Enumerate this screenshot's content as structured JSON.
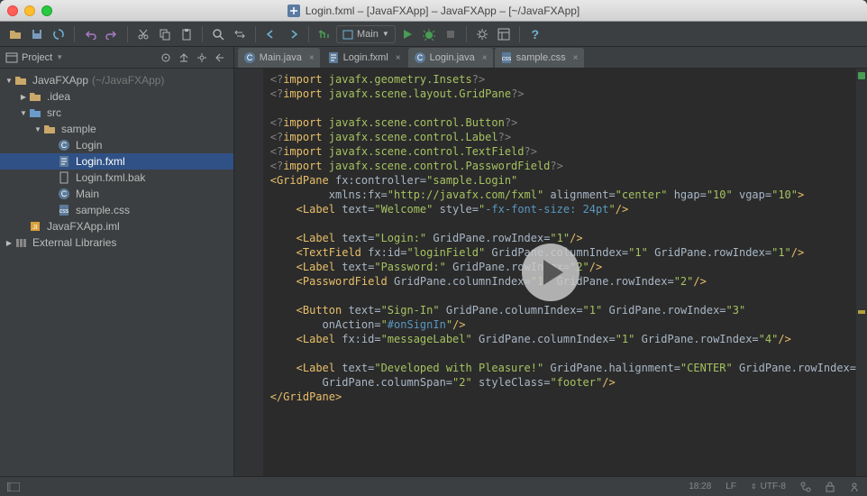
{
  "window_title": "Login.fxml – [JavaFXApp] – JavaFXApp – [~/JavaFXApp]",
  "run_config": "Main",
  "sidebar": {
    "title": "Project",
    "nodes": [
      {
        "indent": 0,
        "arrow": "▼",
        "icon": "folder",
        "label": "JavaFXApp",
        "hint": "(~/JavaFXApp)"
      },
      {
        "indent": 1,
        "arrow": "▶",
        "icon": "folder",
        "label": ".idea",
        "hint": ""
      },
      {
        "indent": 1,
        "arrow": "▼",
        "icon": "src",
        "label": "src",
        "hint": ""
      },
      {
        "indent": 2,
        "arrow": "▼",
        "icon": "pkg",
        "label": "sample",
        "hint": ""
      },
      {
        "indent": 3,
        "arrow": "",
        "icon": "java",
        "label": "Login",
        "hint": ""
      },
      {
        "indent": 3,
        "arrow": "",
        "icon": "fxml",
        "label": "Login.fxml",
        "hint": "",
        "selected": true
      },
      {
        "indent": 3,
        "arrow": "",
        "icon": "file",
        "label": "Login.fxml.bak",
        "hint": ""
      },
      {
        "indent": 3,
        "arrow": "",
        "icon": "java",
        "label": "Main",
        "hint": ""
      },
      {
        "indent": 3,
        "arrow": "",
        "icon": "css",
        "label": "sample.css",
        "hint": ""
      },
      {
        "indent": 1,
        "arrow": "",
        "icon": "iml",
        "label": "JavaFXApp.iml",
        "hint": ""
      },
      {
        "indent": 0,
        "arrow": "▶",
        "icon": "lib",
        "label": "External Libraries",
        "hint": ""
      }
    ]
  },
  "tabs": [
    {
      "icon": "java",
      "label": "Main.java",
      "active": false
    },
    {
      "icon": "fxml",
      "label": "Login.fxml",
      "active": true
    },
    {
      "icon": "java",
      "label": "Login.java",
      "active": false
    },
    {
      "icon": "css",
      "label": "sample.css",
      "active": false
    }
  ],
  "code_html": "<span class='dim'>&lt;?</span><span class='tag'>import </span><span class='str'>javafx.geometry.Insets</span><span class='dim'>?&gt;</span>\n<span class='dim'>&lt;?</span><span class='tag'>import </span><span class='str'>javafx.scene.layout.GridPane</span><span class='dim'>?&gt;</span>\n\n<span class='dim'>&lt;?</span><span class='tag'>import </span><span class='str'>javafx.scene.control.Button</span><span class='dim'>?&gt;</span>\n<span class='dim'>&lt;?</span><span class='tag'>import </span><span class='str'>javafx.scene.control.Label</span><span class='dim'>?&gt;</span>\n<span class='dim'>&lt;?</span><span class='tag'>import </span><span class='str'>javafx.scene.control.TextField</span><span class='dim'>?&gt;</span>\n<span class='dim'>&lt;?</span><span class='tag'>import </span><span class='str'>javafx.scene.control.PasswordField</span><span class='dim'>?&gt;</span>\n<span class='tag'>&lt;GridPane </span><span class='attr'>fx:controller=</span><span class='str'>\"sample.Login\"</span>\n         <span class='attr'>xmlns:fx=</span><span class='str'>\"http://javafx.com/fxml\"</span> <span class='attr'>alignment=</span><span class='str'>\"center\"</span> <span class='attr'>hgap=</span><span class='str'>\"10\"</span> <span class='attr'>vgap=</span><span class='str'>\"10\"</span><span class='tag'>&gt;</span>\n    <span class='tag'>&lt;Label </span><span class='attr'>text=</span><span class='str'>\"Welcome\"</span> <span class='attr'>style=</span><span class='str'>\"</span><span class='hl'>-fx-font-size: 24pt</span><span class='str'>\"</span><span class='tag'>/&gt;</span>\n\n    <span class='tag'>&lt;Label </span><span class='attr'>text=</span><span class='str'>\"Login:\"</span> <span class='attr'>GridPane.rowIndex=</span><span class='str'>\"1\"</span><span class='tag'>/&gt;</span>\n    <span class='tag'>&lt;TextField </span><span class='attr'>fx:id=</span><span class='str'>\"loginField\"</span> <span class='attr'>GridPane.columnIndex=</span><span class='str'>\"1\"</span> <span class='attr'>GridPane.rowIndex=</span><span class='str'>\"1\"</span><span class='tag'>/&gt;</span>\n    <span class='tag'>&lt;Label </span><span class='attr'>text=</span><span class='str'>\"Password:\"</span> <span class='attr'>GridPane.rowIndex=</span><span class='str'>\"2\"</span><span class='tag'>/&gt;</span>\n    <span class='tag'>&lt;PasswordField </span><span class='attr'>GridPane.columnIndex=</span><span class='str'>\"1\"</span> <span class='attr'>GridPane.rowIndex=</span><span class='str'>\"2\"</span><span class='tag'>/&gt;</span>\n\n    <span class='tag'>&lt;Button </span><span class='attr'>text=</span><span class='str'>\"Sign-In\"</span> <span class='attr'>GridPane.columnIndex=</span><span class='str'>\"1\"</span> <span class='attr'>GridPane.rowIndex=</span><span class='str'>\"3\"</span>\n        <span class='attr'>onAction=</span><span class='str'>\"</span><span class='hl'>#onSignIn</span><span class='str'>\"</span><span class='tag'>/&gt;</span>\n    <span class='tag'>&lt;Label </span><span class='attr'>fx:id=</span><span class='str'>\"messageLabel\"</span> <span class='attr'>GridPane.columnIndex=</span><span class='str'>\"1\"</span> <span class='attr'>GridPane.rowIndex=</span><span class='str'>\"4\"</span><span class='tag'>/&gt;</span>\n\n    <span class='tag'>&lt;Label </span><span class='attr'>text=</span><span class='str'>\"Developed with Pleasure!\"</span> <span class='attr'>GridPane.halignment=</span><span class='str'>\"CENTER\"</span> <span class='attr'>GridPane.rowIndex=</span>\n        <span class='attr'>GridPane.columnSpan=</span><span class='str'>\"2\"</span> <span class='attr'>styleClass=</span><span class='str'>\"footer\"</span><span class='tag'>/&gt;</span>\n<span class='tag'>&lt;/GridPane&gt;</span>",
  "status": {
    "pos": "18:28",
    "lf": "LF",
    "enc": "UTF-8"
  }
}
